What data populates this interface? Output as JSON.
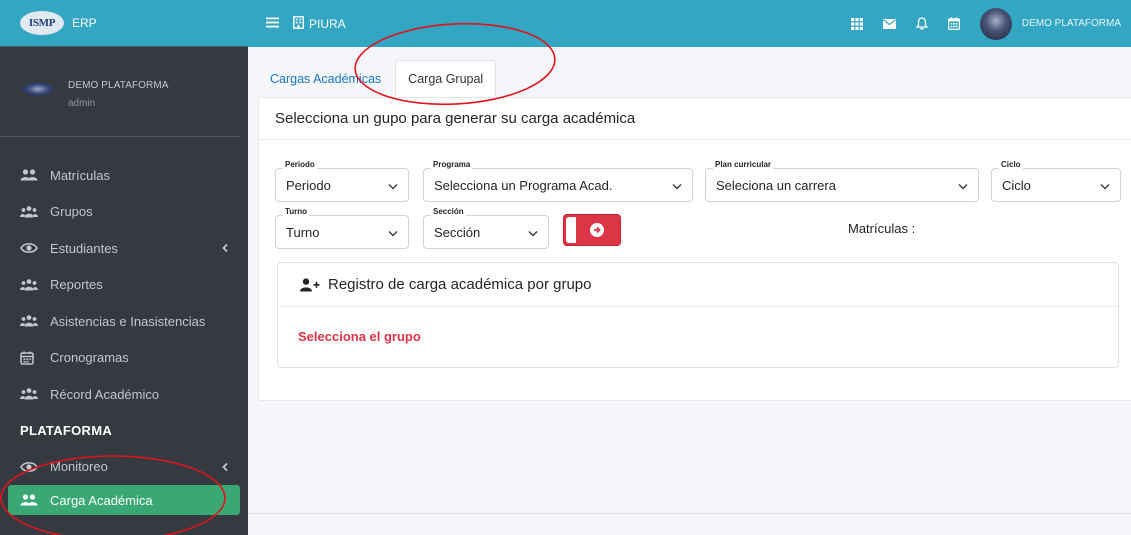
{
  "brand": {
    "logo_text": "ISMP",
    "app_name": "ERP"
  },
  "user_panel": {
    "name": "DEMO PLATAFORMA",
    "role": "admin"
  },
  "sidebar": {
    "items": [
      {
        "label": "Matrículas",
        "icon": "users-icon"
      },
      {
        "label": "Grupos",
        "icon": "users-group-icon"
      },
      {
        "label": "Estudiantes",
        "icon": "eye-icon",
        "has_caret": true
      },
      {
        "label": "Reportes",
        "icon": "users-group-icon"
      },
      {
        "label": "Asistencias e Inasistencias",
        "icon": "users-group-icon"
      },
      {
        "label": "Cronogramas",
        "icon": "calendar-icon"
      },
      {
        "label": "Récord Académico",
        "icon": "users-group-icon"
      }
    ],
    "section_header": "PLATAFORMA",
    "platform_items": [
      {
        "label": "Monitoreo",
        "icon": "eye-icon",
        "has_caret": true
      },
      {
        "label": "Carga Académica",
        "icon": "users-icon",
        "active": true
      }
    ]
  },
  "navbar": {
    "org_label": "PIURA",
    "user_name": "DEMO PLATAFORMA",
    "icons": [
      "grid-icon",
      "mail-icon",
      "bell-icon",
      "calendar-icon"
    ]
  },
  "tabs": [
    {
      "label": "Cargas Académicas",
      "active": false
    },
    {
      "label": "Carga Grupal",
      "active": true
    }
  ],
  "card": {
    "title": "Selecciona un gupo para generar su carga académica",
    "fields": {
      "periodo": {
        "label": "Periodo",
        "value": "Periodo"
      },
      "programa": {
        "label": "Programa",
        "value": "Selecciona un Programa Acad."
      },
      "plan": {
        "label": "Plan curricular",
        "value": "Seleciona un carrera"
      },
      "ciclo": {
        "label": "Ciclo",
        "value": "Ciclo"
      },
      "turno": {
        "label": "Turno",
        "value": "Turno"
      },
      "seccion": {
        "label": "Sección",
        "value": "Sección"
      }
    },
    "matriculas_label": "Matrículas :",
    "registro": {
      "title": "Registro de carga académica por grupo",
      "message": "Selecciona el grupo"
    }
  },
  "colors": {
    "primary": "#32a6c2",
    "sidebar": "#343a40",
    "active_item": "#3aa875",
    "danger": "#dc3545",
    "annotation": "#e0141c"
  }
}
